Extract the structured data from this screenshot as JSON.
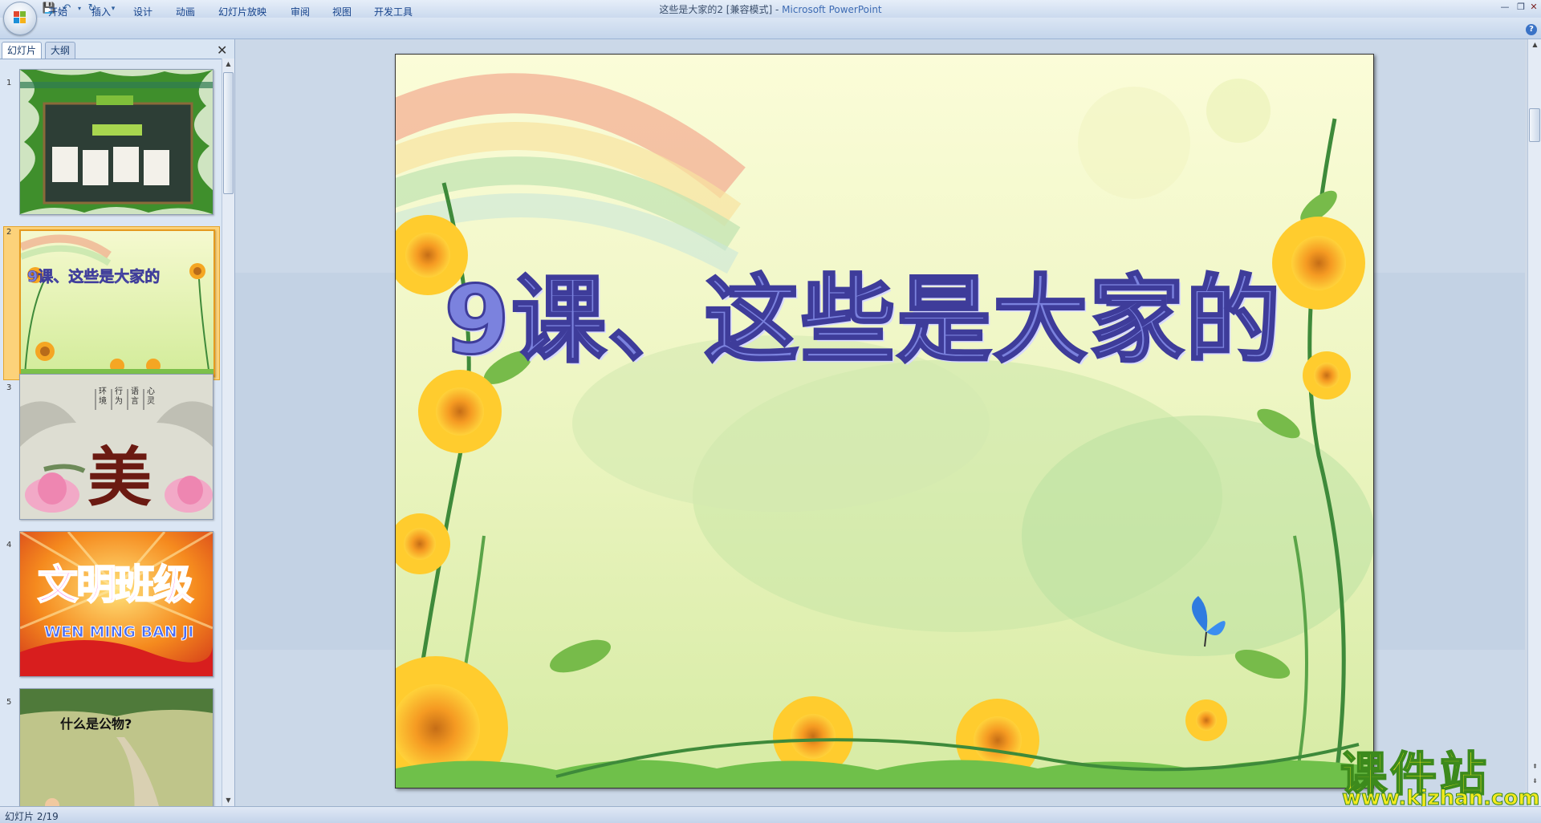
{
  "window": {
    "doc_name": "这些是大家的2 [兼容模式]",
    "separator": " - ",
    "app_name": "Microsoft PowerPoint"
  },
  "qat": {
    "save_icon": "save-icon",
    "undo_icon": "undo-icon",
    "redo_icon": "redo-icon",
    "customize_icon": "dropdown-icon"
  },
  "ribbon_tabs": [
    "开始",
    "插入",
    "设计",
    "动画",
    "幻灯片放映",
    "审阅",
    "视图",
    "开发工具"
  ],
  "pane_tabs": {
    "slides": "幻灯片",
    "outline": "大纲",
    "close": "✕"
  },
  "thumbnails": [
    {
      "num": "1"
    },
    {
      "num": "2",
      "title": "9课、这些是大家的",
      "selected": true
    },
    {
      "num": "3",
      "words": [
        "环境",
        "行为",
        "语言",
        "心灵"
      ],
      "big": "美"
    },
    {
      "num": "4",
      "title": "文明班级",
      "subtitle": "WEN MING BAN JI"
    },
    {
      "num": "5",
      "title": "什么是公物?"
    }
  ],
  "slide": {
    "title": "9课、这些是大家的"
  },
  "status": {
    "text": "幻灯片 2/19"
  },
  "watermark": {
    "cn": "课件站",
    "url": "www.kjzhan.com"
  },
  "colors": {
    "ribbon": "#c4d5eb",
    "selected_thumb": "#fcd27a",
    "title_fill": "#7b82de",
    "title_stroke": "#3e3c9a"
  }
}
